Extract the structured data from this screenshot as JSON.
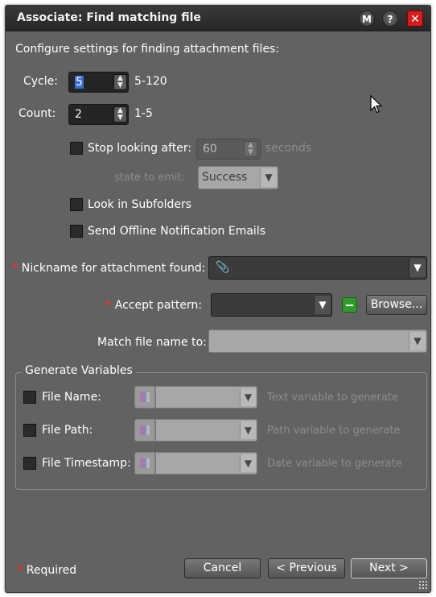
{
  "dialog": {
    "title": "Associate: Find matching file",
    "title_buttons": {
      "m": "M",
      "help": "?",
      "close": "✕"
    },
    "description": "Configure settings for finding attachment files:"
  },
  "cycle": {
    "label": "Cycle:",
    "value": "5",
    "range": "5-120"
  },
  "count": {
    "label": "Count:",
    "value": "2",
    "range": "1-5"
  },
  "stop_looking": {
    "label": "Stop looking after:",
    "value": "60",
    "unit": "seconds",
    "checked": false
  },
  "state_to_emit": {
    "label": "state to emit:",
    "value": "Success"
  },
  "look_in_subfolders": {
    "label": "Look in Subfolders",
    "checked": false
  },
  "send_offline": {
    "label": "Send Offline Notification Emails",
    "checked": false
  },
  "nickname": {
    "label": "Nickname for attachment found:",
    "value": ""
  },
  "accept_pattern": {
    "label": "Accept pattern:",
    "value": "",
    "browse_label": "Browse..."
  },
  "match_file_name": {
    "label": "Match file name to:",
    "value": ""
  },
  "generate_variables": {
    "title": "Generate Variables",
    "rows": [
      {
        "label": "File Name:",
        "placeholder": "Text variable to generate"
      },
      {
        "label": "File Path:",
        "placeholder": "Path variable to generate"
      },
      {
        "label": "File Timestamp:",
        "placeholder": "Date variable to generate"
      }
    ]
  },
  "footer": {
    "required_label": "Required",
    "cancel": "Cancel",
    "previous": "< Previous",
    "next": "Next >"
  },
  "colors": {
    "dialog_bg": "#626262",
    "titlebar_bg": "#2e2e2e",
    "required_star": "#e8332b",
    "close_button": "#d41e1e",
    "remove_button": "#2f9a2a"
  }
}
